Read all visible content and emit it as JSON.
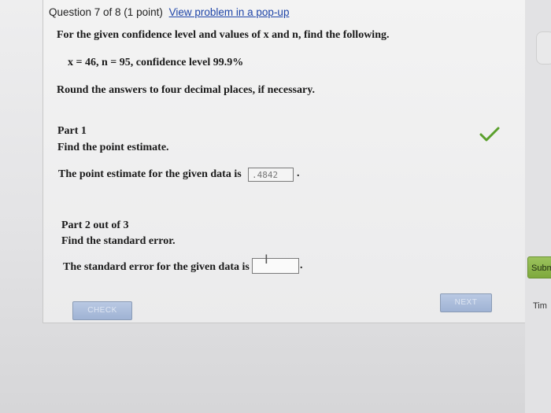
{
  "header": {
    "question_label": "Question 7 of 8 (1 point)",
    "popup_link": "View problem in a pop-up"
  },
  "question": {
    "instruction": "For the given confidence level and values of x and n, find the following.",
    "given_values": "x = 46, n = 95, confidence level 99.9%",
    "rounding_note": "Round the answers to four decimal places, if necessary."
  },
  "part1": {
    "title": "Part 1",
    "subtitle": "Find the point estimate.",
    "statement": "The point estimate for the given data is",
    "answer_value": ".4842",
    "status_icon": "check-icon"
  },
  "part2": {
    "title": "Part 2 out of 3",
    "subtitle": "Find the standard error.",
    "statement": "The standard error for the given data is",
    "answer_value": ""
  },
  "buttons": {
    "check": "CHECK",
    "next": "NEXT",
    "submit": "Subm"
  },
  "timer_label": "Tim",
  "colors": {
    "link": "#1f45a8",
    "check_mark": "#5aa02c",
    "submit_green": "#8bb84a",
    "button_blue": "#a9bcdc"
  }
}
